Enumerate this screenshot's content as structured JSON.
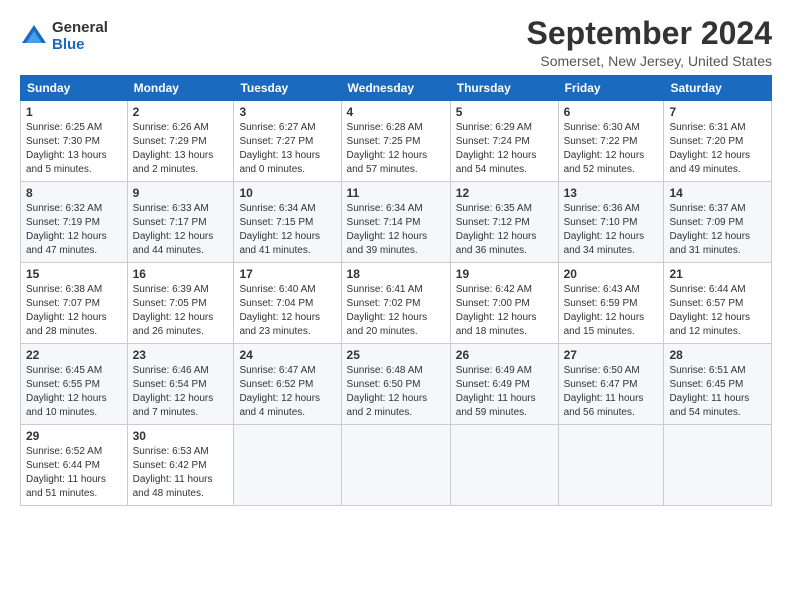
{
  "logo": {
    "general": "General",
    "blue": "Blue"
  },
  "header": {
    "title": "September 2024",
    "subtitle": "Somerset, New Jersey, United States"
  },
  "weekdays": [
    "Sunday",
    "Monday",
    "Tuesday",
    "Wednesday",
    "Thursday",
    "Friday",
    "Saturday"
  ],
  "weeks": [
    [
      {
        "day": "1",
        "info": "Sunrise: 6:25 AM\nSunset: 7:30 PM\nDaylight: 13 hours\nand 5 minutes."
      },
      {
        "day": "2",
        "info": "Sunrise: 6:26 AM\nSunset: 7:29 PM\nDaylight: 13 hours\nand 2 minutes."
      },
      {
        "day": "3",
        "info": "Sunrise: 6:27 AM\nSunset: 7:27 PM\nDaylight: 13 hours\nand 0 minutes."
      },
      {
        "day": "4",
        "info": "Sunrise: 6:28 AM\nSunset: 7:25 PM\nDaylight: 12 hours\nand 57 minutes."
      },
      {
        "day": "5",
        "info": "Sunrise: 6:29 AM\nSunset: 7:24 PM\nDaylight: 12 hours\nand 54 minutes."
      },
      {
        "day": "6",
        "info": "Sunrise: 6:30 AM\nSunset: 7:22 PM\nDaylight: 12 hours\nand 52 minutes."
      },
      {
        "day": "7",
        "info": "Sunrise: 6:31 AM\nSunset: 7:20 PM\nDaylight: 12 hours\nand 49 minutes."
      }
    ],
    [
      {
        "day": "8",
        "info": "Sunrise: 6:32 AM\nSunset: 7:19 PM\nDaylight: 12 hours\nand 47 minutes."
      },
      {
        "day": "9",
        "info": "Sunrise: 6:33 AM\nSunset: 7:17 PM\nDaylight: 12 hours\nand 44 minutes."
      },
      {
        "day": "10",
        "info": "Sunrise: 6:34 AM\nSunset: 7:15 PM\nDaylight: 12 hours\nand 41 minutes."
      },
      {
        "day": "11",
        "info": "Sunrise: 6:34 AM\nSunset: 7:14 PM\nDaylight: 12 hours\nand 39 minutes."
      },
      {
        "day": "12",
        "info": "Sunrise: 6:35 AM\nSunset: 7:12 PM\nDaylight: 12 hours\nand 36 minutes."
      },
      {
        "day": "13",
        "info": "Sunrise: 6:36 AM\nSunset: 7:10 PM\nDaylight: 12 hours\nand 34 minutes."
      },
      {
        "day": "14",
        "info": "Sunrise: 6:37 AM\nSunset: 7:09 PM\nDaylight: 12 hours\nand 31 minutes."
      }
    ],
    [
      {
        "day": "15",
        "info": "Sunrise: 6:38 AM\nSunset: 7:07 PM\nDaylight: 12 hours\nand 28 minutes."
      },
      {
        "day": "16",
        "info": "Sunrise: 6:39 AM\nSunset: 7:05 PM\nDaylight: 12 hours\nand 26 minutes."
      },
      {
        "day": "17",
        "info": "Sunrise: 6:40 AM\nSunset: 7:04 PM\nDaylight: 12 hours\nand 23 minutes."
      },
      {
        "day": "18",
        "info": "Sunrise: 6:41 AM\nSunset: 7:02 PM\nDaylight: 12 hours\nand 20 minutes."
      },
      {
        "day": "19",
        "info": "Sunrise: 6:42 AM\nSunset: 7:00 PM\nDaylight: 12 hours\nand 18 minutes."
      },
      {
        "day": "20",
        "info": "Sunrise: 6:43 AM\nSunset: 6:59 PM\nDaylight: 12 hours\nand 15 minutes."
      },
      {
        "day": "21",
        "info": "Sunrise: 6:44 AM\nSunset: 6:57 PM\nDaylight: 12 hours\nand 12 minutes."
      }
    ],
    [
      {
        "day": "22",
        "info": "Sunrise: 6:45 AM\nSunset: 6:55 PM\nDaylight: 12 hours\nand 10 minutes."
      },
      {
        "day": "23",
        "info": "Sunrise: 6:46 AM\nSunset: 6:54 PM\nDaylight: 12 hours\nand 7 minutes."
      },
      {
        "day": "24",
        "info": "Sunrise: 6:47 AM\nSunset: 6:52 PM\nDaylight: 12 hours\nand 4 minutes."
      },
      {
        "day": "25",
        "info": "Sunrise: 6:48 AM\nSunset: 6:50 PM\nDaylight: 12 hours\nand 2 minutes."
      },
      {
        "day": "26",
        "info": "Sunrise: 6:49 AM\nSunset: 6:49 PM\nDaylight: 11 hours\nand 59 minutes."
      },
      {
        "day": "27",
        "info": "Sunrise: 6:50 AM\nSunset: 6:47 PM\nDaylight: 11 hours\nand 56 minutes."
      },
      {
        "day": "28",
        "info": "Sunrise: 6:51 AM\nSunset: 6:45 PM\nDaylight: 11 hours\nand 54 minutes."
      }
    ],
    [
      {
        "day": "29",
        "info": "Sunrise: 6:52 AM\nSunset: 6:44 PM\nDaylight: 11 hours\nand 51 minutes."
      },
      {
        "day": "30",
        "info": "Sunrise: 6:53 AM\nSunset: 6:42 PM\nDaylight: 11 hours\nand 48 minutes."
      },
      null,
      null,
      null,
      null,
      null
    ]
  ]
}
